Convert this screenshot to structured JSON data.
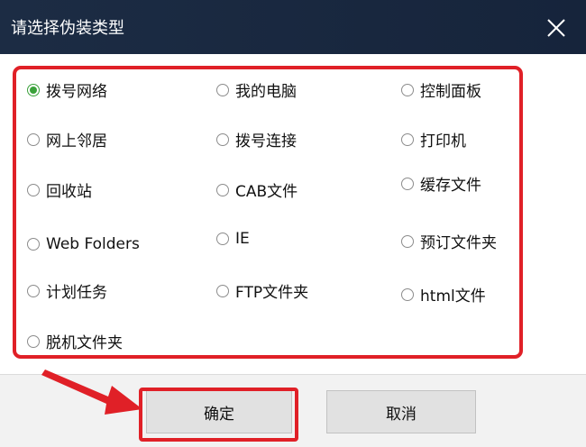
{
  "dialog": {
    "title": "请选择伪装类型",
    "selected": "拨号网络",
    "options": [
      "拨号网络",
      "我的电脑",
      "控制面板",
      "网上邻居",
      "拨号连接",
      "打印机",
      "回收站",
      "CAB文件",
      "缓存文件",
      "Web Folders",
      "IE",
      "预订文件夹",
      "计划任务",
      "FTP文件夹",
      "html文件",
      "脱机文件夹"
    ]
  },
  "buttons": {
    "ok": "确定",
    "cancel": "取消"
  },
  "colors": {
    "title_bar": "#1c2c44",
    "highlight": "#e02027",
    "radio_selected": "#3aa13a",
    "footer": "#f2f2f2",
    "button": "#e1e1e1"
  },
  "icons": {
    "close": "close-icon",
    "annotation": "red-arrow-icon"
  }
}
